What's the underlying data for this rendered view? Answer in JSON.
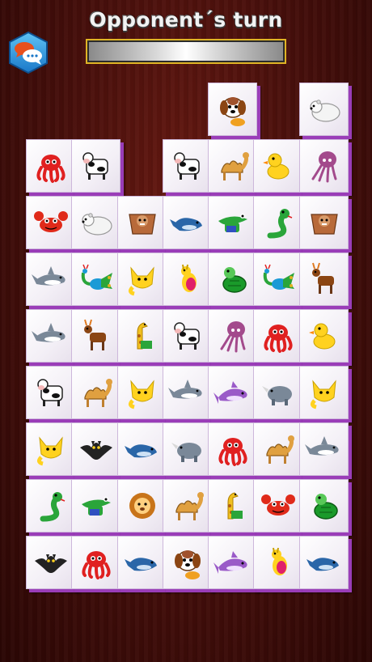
{
  "header": {
    "title": "Opponent´s turn",
    "timer_fraction": 1.0
  },
  "colors": {
    "background": "#4a100c",
    "tile_face": "#f3eff6",
    "tile_side": "#9a3db8",
    "progress_border": "#e0b425"
  },
  "icons": {
    "chat_button": "chat-bubbles-icon"
  },
  "board": {
    "columns": 7,
    "rows": 8,
    "tiles": [
      {
        "row": 0,
        "col": 4,
        "animal": "dog"
      },
      {
        "row": 0,
        "col": 6,
        "animal": "polar-bear"
      },
      {
        "row": 1,
        "col": 0,
        "animal": "octopus"
      },
      {
        "row": 1,
        "col": 1,
        "animal": "cow"
      },
      {
        "row": 1,
        "col": 3,
        "animal": "cow"
      },
      {
        "row": 1,
        "col": 4,
        "animal": "camel"
      },
      {
        "row": 1,
        "col": 5,
        "animal": "duck"
      },
      {
        "row": 1,
        "col": 6,
        "animal": "squid"
      },
      {
        "row": 2,
        "col": 0,
        "animal": "crab"
      },
      {
        "row": 2,
        "col": 1,
        "animal": "polar-bear"
      },
      {
        "row": 2,
        "col": 2,
        "animal": "flying-squirrel"
      },
      {
        "row": 2,
        "col": 3,
        "animal": "whale"
      },
      {
        "row": 2,
        "col": 4,
        "animal": "crocodile"
      },
      {
        "row": 2,
        "col": 5,
        "animal": "snake"
      },
      {
        "row": 2,
        "col": 6,
        "animal": "flying-squirrel"
      },
      {
        "row": 3,
        "col": 0,
        "animal": "shark"
      },
      {
        "row": 3,
        "col": 1,
        "animal": "peacock"
      },
      {
        "row": 3,
        "col": 2,
        "animal": "fox"
      },
      {
        "row": 3,
        "col": 3,
        "animal": "kangaroo"
      },
      {
        "row": 3,
        "col": 4,
        "animal": "turtle"
      },
      {
        "row": 3,
        "col": 5,
        "animal": "peacock"
      },
      {
        "row": 3,
        "col": 6,
        "animal": "deer"
      },
      {
        "row": 4,
        "col": 0,
        "animal": "shark"
      },
      {
        "row": 4,
        "col": 1,
        "animal": "deer"
      },
      {
        "row": 4,
        "col": 2,
        "animal": "giraffe"
      },
      {
        "row": 4,
        "col": 3,
        "animal": "cow"
      },
      {
        "row": 4,
        "col": 4,
        "animal": "squid"
      },
      {
        "row": 4,
        "col": 5,
        "animal": "octopus"
      },
      {
        "row": 4,
        "col": 6,
        "animal": "duck"
      },
      {
        "row": 5,
        "col": 0,
        "animal": "cow"
      },
      {
        "row": 5,
        "col": 1,
        "animal": "camel"
      },
      {
        "row": 5,
        "col": 2,
        "animal": "fox"
      },
      {
        "row": 5,
        "col": 3,
        "animal": "shark"
      },
      {
        "row": 5,
        "col": 4,
        "animal": "dolphin"
      },
      {
        "row": 5,
        "col": 5,
        "animal": "rhino"
      },
      {
        "row": 5,
        "col": 6,
        "animal": "fox"
      },
      {
        "row": 6,
        "col": 0,
        "animal": "fox"
      },
      {
        "row": 6,
        "col": 1,
        "animal": "bat"
      },
      {
        "row": 6,
        "col": 2,
        "animal": "whale"
      },
      {
        "row": 6,
        "col": 3,
        "animal": "rhino"
      },
      {
        "row": 6,
        "col": 4,
        "animal": "octopus"
      },
      {
        "row": 6,
        "col": 5,
        "animal": "camel"
      },
      {
        "row": 6,
        "col": 6,
        "animal": "shark"
      },
      {
        "row": 7,
        "col": 0,
        "animal": "snake"
      },
      {
        "row": 7,
        "col": 1,
        "animal": "crocodile"
      },
      {
        "row": 7,
        "col": 2,
        "animal": "lion"
      },
      {
        "row": 7,
        "col": 3,
        "animal": "camel"
      },
      {
        "row": 7,
        "col": 4,
        "animal": "giraffe"
      },
      {
        "row": 7,
        "col": 5,
        "animal": "crab"
      },
      {
        "row": 7,
        "col": 6,
        "animal": "turtle"
      },
      {
        "row": 8,
        "col": 0,
        "animal": "bat"
      },
      {
        "row": 8,
        "col": 1,
        "animal": "octopus"
      },
      {
        "row": 8,
        "col": 2,
        "animal": "whale"
      },
      {
        "row": 8,
        "col": 3,
        "animal": "dog"
      },
      {
        "row": 8,
        "col": 4,
        "animal": "dolphin"
      },
      {
        "row": 8,
        "col": 5,
        "animal": "kangaroo"
      },
      {
        "row": 8,
        "col": 6,
        "animal": "whale"
      }
    ]
  }
}
